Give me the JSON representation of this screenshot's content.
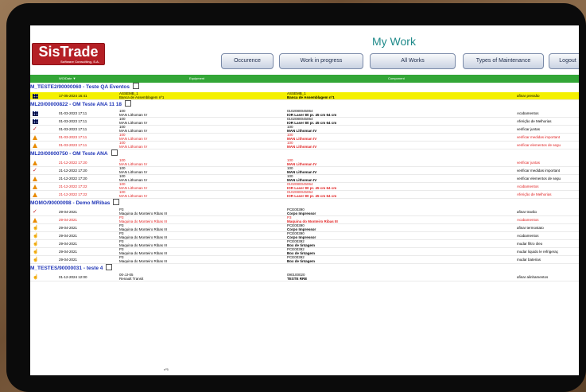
{
  "app": {
    "logo": "SisTrade",
    "logo_sub": "Software Consulting, S.A.",
    "title": "My Work"
  },
  "nav": {
    "occurrence": "Occurence",
    "work_in_progress": "Work in progress",
    "all_works": "All Works",
    "types_of_maintenance": "Types of Maintenance",
    "logout": "Logout"
  },
  "table": {
    "headers": {
      "wo_date": "WO/Date ▼",
      "equipment": "Equipment",
      "component": "Component"
    }
  },
  "groups": [
    {
      "label": "M_TESTE2/90000060 - Teste QA Eventos",
      "rows": [
        {
          "icon": "grid-icon",
          "style": "hl",
          "date": "17-05-2024 16:41",
          "eq1": "ASSEMB_1",
          "eq2": "Banca de Assemblagem nº1",
          "comp1": "ASSEMB_1",
          "comp2": "Banca de Assemblagem nº1",
          "op": "afinar pressão"
        }
      ]
    },
    {
      "label": "ML20/00000822 - OM Teste ANA 11 18",
      "rows": [
        {
          "icon": "grid-icon",
          "style": "",
          "date": "01-03-2023 17:11",
          "eq1": "100",
          "eq2": "MAN Lithoman IV",
          "comp1": "0102080045064",
          "comp2": "IOR Laser 80 pr. 45 cm 64 cm",
          "op": "Acabamentos"
        },
        {
          "icon": "grid-icon",
          "style": "",
          "date": "01-03-2023 17:11",
          "eq1": "100",
          "eq2": "MAN Lithoman IV",
          "comp1": "0102080045064",
          "comp2": "IOR Laser 80 pr. 45 cm 64 cm",
          "op": "Aferição de Melhorias"
        },
        {
          "icon": "check-icon",
          "style": "",
          "date": "01-03-2023 17:11",
          "eq1": "100",
          "eq2": "MAN Lithoman IV",
          "comp1": "100",
          "comp2": "MAN Lithoman IV",
          "op": "verificar juntas"
        },
        {
          "icon": "warning-icon",
          "style": "red",
          "date": "01-03-2023 17:11",
          "eq1": "100",
          "eq2": "MAN Lithoman IV",
          "comp1": "100",
          "comp2": "MAN Lithoman IV",
          "op": "verificar medidas important"
        },
        {
          "icon": "warning-icon",
          "style": "red",
          "date": "01-03-2023 17:11",
          "eq1": "100",
          "eq2": "MAN Lithoman IV",
          "comp1": "100",
          "comp2": "MAN Lithoman IV",
          "op": "verificar elementos de segu"
        }
      ]
    },
    {
      "label": "ML20/00000750 - OM Teste ANA",
      "rows": [
        {
          "icon": "warning-icon",
          "style": "red",
          "date": "21-12-2022 17:20",
          "eq1": "100",
          "eq2": "MAN Lithoman IV",
          "comp1": "100",
          "comp2": "MAN Lithoman IV",
          "op": "verificar juntas"
        },
        {
          "icon": "check-icon",
          "style": "",
          "date": "21-12-2022 17:20",
          "eq1": "100",
          "eq2": "MAN Lithoman IV",
          "comp1": "100",
          "comp2": "MAN Lithoman IV",
          "op": "verificar medidas important"
        },
        {
          "icon": "warning-icon",
          "style": "",
          "date": "21-12-2022 17:20",
          "eq1": "100",
          "eq2": "MAN Lithoman IV",
          "comp1": "100",
          "comp2": "MAN Lithoman IV",
          "op": "verificar elementos de segu"
        },
        {
          "icon": "warning-icon",
          "style": "red",
          "date": "21-12-2022 17:22",
          "eq1": "100",
          "eq2": "MAN Lithoman IV",
          "comp1": "0102080045064",
          "comp2": "IOR Laser 80 pr. 45 cm 64 cm",
          "op": "Acabamentos"
        },
        {
          "icon": "warning-icon",
          "style": "red",
          "date": "21-12-2022 17:22",
          "eq1": "100",
          "eq2": "MAN Lithoman IV",
          "comp1": "0102080045064",
          "comp2": "IOR Laser 80 pr. 45 cm 64 cm",
          "op": "Aferição de Melhorias"
        }
      ]
    },
    {
      "label": "MOMO/90000098 - Demo MRibas",
      "rows": [
        {
          "icon": "check-icon",
          "style": "",
          "date": "29-04-2021",
          "eq1": "P3",
          "eq2": "Maquina do Monteiro Ribas III",
          "comp1": "PCE00390",
          "comp2": "Corpo Impressor",
          "op": "afinar travão"
        },
        {
          "icon": "warning-icon",
          "style": "red",
          "date": "29-04-2021",
          "eq1": "P3",
          "eq2": "Maquina do Monteiro Ribas III",
          "comp1": "P3",
          "comp2": "Maquina do Monteiro Ribas III",
          "op": "Acabamentos"
        },
        {
          "icon": "hand-icon",
          "style": "",
          "date": "29-04-2021",
          "eq1": "P3",
          "eq2": "Maquina do Monteiro Ribas III",
          "comp1": "PCE00390",
          "comp2": "Corpo Impressor",
          "op": "afinar termostato"
        },
        {
          "icon": "hand-icon",
          "style": "",
          "date": "29-04-2021",
          "eq1": "P3",
          "eq2": "Maquina do Monteiro Ribas III",
          "comp1": "PCE00390",
          "comp2": "Corpo Impressor",
          "op": "Acabamentos"
        },
        {
          "icon": "hand-icon",
          "style": "",
          "date": "29-04-2021",
          "eq1": "P3",
          "eq2": "Maquina do Monteiro Ribas III",
          "comp1": "PCE00392",
          "comp2": "Box de tintagem",
          "op": "mudar filtro óleo"
        },
        {
          "icon": "hand-icon",
          "style": "",
          "date": "29-04-2021",
          "eq1": "P3",
          "eq2": "Maquina do Monteiro Ribas III",
          "comp1": "PCE00392",
          "comp2": "Box de tintagem",
          "op": "mudar liquido le refrigeraç"
        },
        {
          "icon": "hand-icon",
          "style": "",
          "date": "29-04-2021",
          "eq1": "P3",
          "eq2": "Maquina do Monteiro Ribas III",
          "comp1": "PCE00392",
          "comp2": "Box de tintagem",
          "op": "mudar baterias"
        }
      ]
    },
    {
      "label": "M_TESTES/90000031 - teste 4",
      "rows": [
        {
          "icon": "hand-icon",
          "style": "",
          "date": "01-12-2024 12:00",
          "eq1": "00-JJ-05",
          "eq2": "Renault Transit",
          "comp1": "090100020",
          "comp2": "TESTE RRE",
          "op": "afinar alinhamentos"
        }
      ]
    }
  ],
  "footer": {
    "page_mark": "nº5"
  },
  "colors": {
    "brand": "#b41f25",
    "header_green": "#33a637",
    "title_teal": "#1f8a8a",
    "group_blue": "#2036b8",
    "highlight": "#f4f000",
    "alert_red": "#e02020"
  }
}
